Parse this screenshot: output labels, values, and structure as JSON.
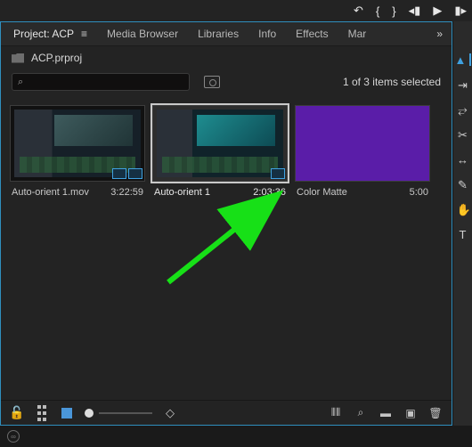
{
  "transport_icons": [
    "↶",
    "{",
    "}",
    "↺",
    "◁|",
    "▶",
    "|▷"
  ],
  "tabs": [
    {
      "label": "Project: ACP",
      "active": true
    },
    {
      "label": "Media Browser"
    },
    {
      "label": "Libraries"
    },
    {
      "label": "Info"
    },
    {
      "label": "Effects"
    },
    {
      "label": "Mar"
    }
  ],
  "project_file": "ACP.prproj",
  "search_placeholder": "",
  "selection_text": "1 of 3 items selected",
  "clips": [
    {
      "name": "Auto-orient 1.mov",
      "duration": "3:22:59",
      "selected": false,
      "kind": "video_a"
    },
    {
      "name": "Auto-orient 1",
      "duration": "2:03:36",
      "selected": true,
      "kind": "video_b"
    },
    {
      "name": "Color Matte",
      "duration": "5:00",
      "selected": false,
      "kind": "matte"
    }
  ],
  "rightstrip_tools": [
    "▶",
    "⇔",
    "✂",
    "⊓",
    "↔",
    "✎",
    "✖",
    "T"
  ]
}
